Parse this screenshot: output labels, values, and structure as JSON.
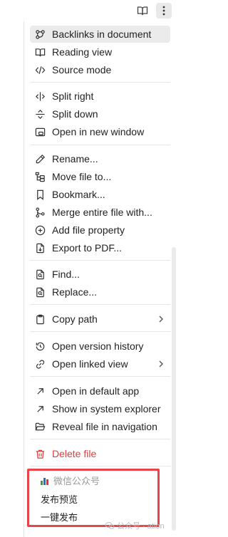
{
  "menu": {
    "items": [
      {
        "label": "Backlinks in document",
        "icon": "backlinks-icon"
      },
      {
        "label": "Reading view",
        "icon": "book-open-icon"
      },
      {
        "label": "Source mode",
        "icon": "code-icon"
      },
      {
        "label": "Split right",
        "icon": "split-right-icon"
      },
      {
        "label": "Split down",
        "icon": "split-down-icon"
      },
      {
        "label": "Open in new window",
        "icon": "new-window-icon"
      },
      {
        "label": "Rename...",
        "icon": "pencil-icon"
      },
      {
        "label": "Move file to...",
        "icon": "folder-tree-icon"
      },
      {
        "label": "Bookmark...",
        "icon": "bookmark-icon"
      },
      {
        "label": "Merge entire file with...",
        "icon": "git-merge-icon"
      },
      {
        "label": "Add file property",
        "icon": "plus-circle-icon"
      },
      {
        "label": "Export to PDF...",
        "icon": "file-export-icon"
      },
      {
        "label": "Find...",
        "icon": "file-search-icon"
      },
      {
        "label": "Replace...",
        "icon": "file-replace-icon"
      },
      {
        "label": "Copy path",
        "icon": "clipboard-icon"
      },
      {
        "label": "Open version history",
        "icon": "history-icon"
      },
      {
        "label": "Open linked view",
        "icon": "link-icon"
      },
      {
        "label": "Open in default app",
        "icon": "arrow-up-right-icon"
      },
      {
        "label": "Show in system explorer",
        "icon": "arrow-up-right-icon"
      },
      {
        "label": "Reveal file in navigation",
        "icon": "folder-open-icon"
      },
      {
        "label": "Delete file",
        "icon": "trash-icon"
      }
    ]
  },
  "plugin": {
    "title": "微信公众号",
    "preview": "发布预览",
    "publish": "一键发布"
  },
  "watermark": "公众号 · ation",
  "colors": {
    "danger": "#d8403b",
    "highlight_box": "#e8454a",
    "hover": "#ebebeb"
  }
}
